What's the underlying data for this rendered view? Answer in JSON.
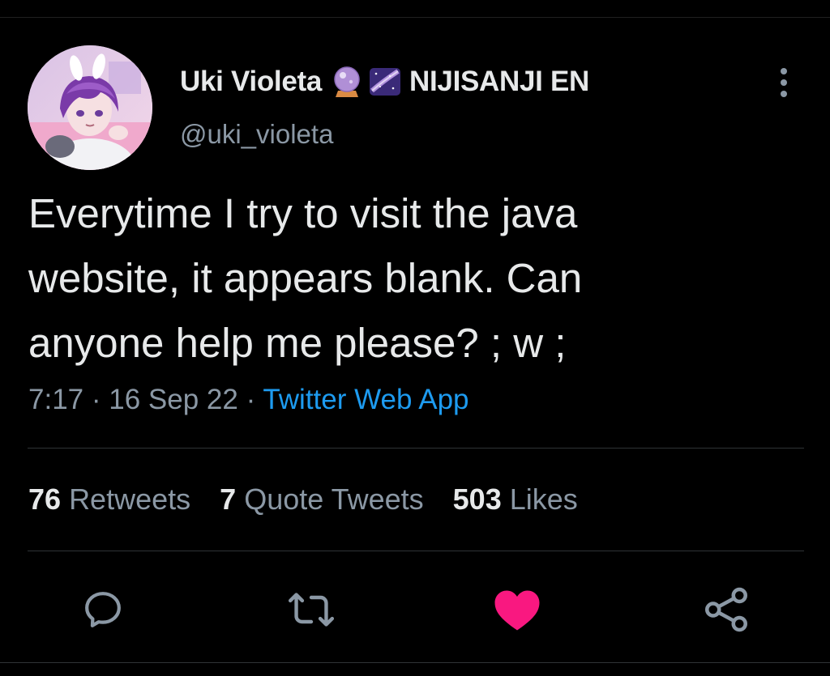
{
  "tweet": {
    "author": {
      "display_name": "Uki Violeta",
      "emojis": [
        "crystal-ball-icon",
        "milky-way-icon"
      ],
      "affiliation": "NIJISANJI EN",
      "handle": "@uki_violeta"
    },
    "text_lines": [
      "Everytime I try to visit the java",
      "website, it appears blank. Can",
      "anyone help me please? ; w ;"
    ],
    "time": "7:17",
    "date": "16 Sep 22",
    "separator": "·",
    "source": "Twitter Web App",
    "stats": {
      "retweets": {
        "count": "76",
        "label": "Retweets"
      },
      "quote_tweets": {
        "count": "7",
        "label": "Quote Tweets"
      },
      "likes": {
        "count": "503",
        "label": "Likes"
      }
    },
    "liked": true
  },
  "colors": {
    "background": "#000000",
    "text": "#e7e9ea",
    "secondary": "#8b98a5",
    "link": "#1d9bf0",
    "like": "#f91880",
    "divider": "#2f3336"
  },
  "actions": [
    "reply-icon",
    "retweet-icon",
    "like-icon",
    "share-icon"
  ]
}
